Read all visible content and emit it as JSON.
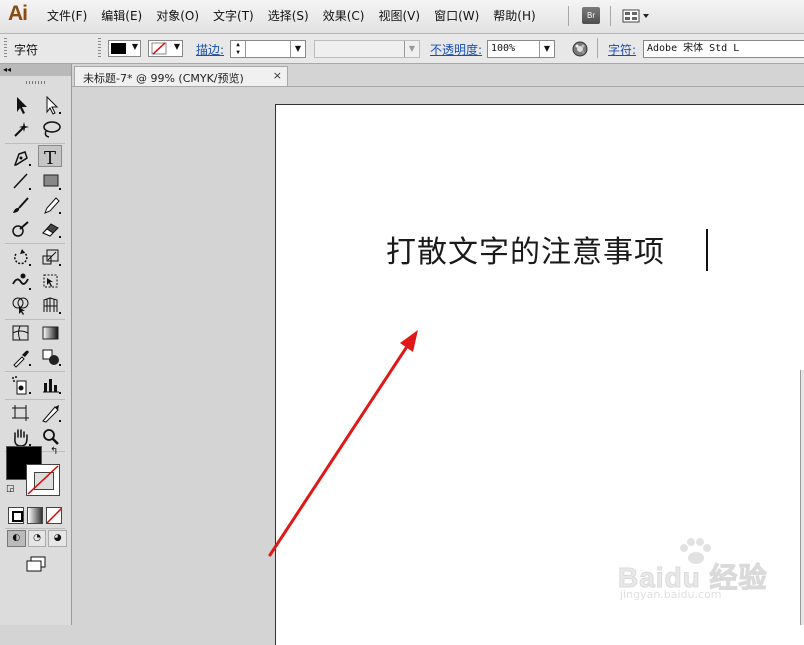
{
  "app": {
    "logo": "Ai"
  },
  "menu": {
    "items": [
      "文件(F)",
      "编辑(E)",
      "对象(O)",
      "文字(T)",
      "选择(S)",
      "效果(C)",
      "视图(V)",
      "窗口(W)",
      "帮助(H)"
    ],
    "bridge_label": "Br"
  },
  "control_bar": {
    "panel_name": "字符",
    "stroke_label": "描边:",
    "opacity_label": "不透明度:",
    "opacity_value": "100%",
    "font_label": "字符:",
    "font_value": "Adobe 宋体 Std L"
  },
  "document": {
    "tab_label": "未标题-7* @ 99% (CMYK/预览)",
    "close_glyph": "×",
    "artboard_text": "打散文字的注意事项"
  },
  "colors": {
    "fill": "#000000",
    "annotation_arrow": "#e01818",
    "logo": "#8a4b0e"
  },
  "watermark": {
    "brand": "Baidu 经验",
    "url": "jingyan.baidu.com"
  }
}
